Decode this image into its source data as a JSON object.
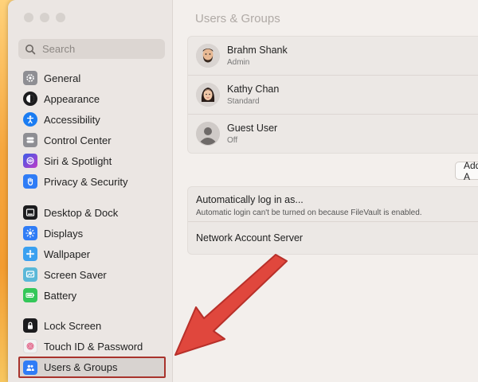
{
  "search": {
    "placeholder": "Search"
  },
  "sidebar": {
    "items": [
      {
        "label": "General",
        "icon": "gear-icon",
        "color": "#8e8e93"
      },
      {
        "label": "Appearance",
        "icon": "appearance-icon",
        "color": "#1c1c1e"
      },
      {
        "label": "Accessibility",
        "icon": "accessibility-icon",
        "color": "#1a7cf2"
      },
      {
        "label": "Control Center",
        "icon": "control-center-icon",
        "color": "#8e8e93"
      },
      {
        "label": "Siri & Spotlight",
        "icon": "siri-icon",
        "color": "#7a4ee0"
      },
      {
        "label": "Privacy & Security",
        "icon": "hand-icon",
        "color": "#2f7cf6"
      },
      {
        "label": "Desktop & Dock",
        "icon": "dock-icon",
        "color": "#1c1c1e"
      },
      {
        "label": "Displays",
        "icon": "display-icon",
        "color": "#2f7cf6"
      },
      {
        "label": "Wallpaper",
        "icon": "wallpaper-icon",
        "color": "#3aa0f0"
      },
      {
        "label": "Screen Saver",
        "icon": "screen-saver-icon",
        "color": "#5ab8d8"
      },
      {
        "label": "Battery",
        "icon": "battery-icon",
        "color": "#34c759"
      },
      {
        "label": "Lock Screen",
        "icon": "lock-icon",
        "color": "#1c1c1e"
      },
      {
        "label": "Touch ID & Password",
        "icon": "fingerprint-icon",
        "color": "#f2f2f2"
      },
      {
        "label": "Users & Groups",
        "icon": "users-icon",
        "color": "#2f7cf6"
      }
    ]
  },
  "main": {
    "title": "Users & Groups",
    "users": [
      {
        "name": "Brahm Shank",
        "role": "Admin"
      },
      {
        "name": "Kathy Chan",
        "role": "Standard"
      },
      {
        "name": "Guest User",
        "role": "Off"
      }
    ],
    "add_label": "Add A",
    "auto_login": {
      "title": "Automatically log in as...",
      "note": "Automatic login can't be turned on because FileVault is enabled."
    },
    "network_server": "Network Account Server"
  },
  "colors": {
    "highlight": "#a8332c",
    "arrow": "#e0473d"
  }
}
